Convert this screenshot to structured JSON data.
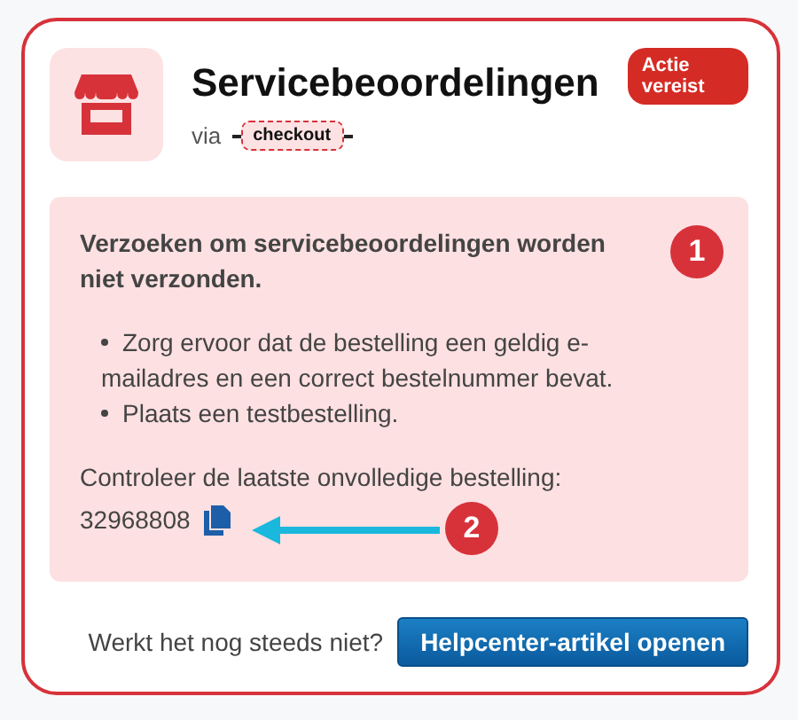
{
  "header": {
    "title": "Servicebeoordelingen",
    "via_label": "via",
    "source_tag": "checkout",
    "status_badge": "Actie vereist"
  },
  "alert": {
    "heading": "Verzoeken om servicebeoordelingen worden niet verzonden.",
    "bullets": [
      "Zorg ervoor dat de bestelling een geldig e-mailadres en een correct bestelnummer bevat.",
      "Plaats een testbestelling."
    ],
    "order_label": "Controleer de laatste onvolledige bestelling:",
    "order_number": "32968808"
  },
  "annotations": [
    {
      "label": "1"
    },
    {
      "label": "2"
    }
  ],
  "footer": {
    "question": "Werkt het nog steeds niet?",
    "button": "Helpcenter-artikel openen"
  }
}
